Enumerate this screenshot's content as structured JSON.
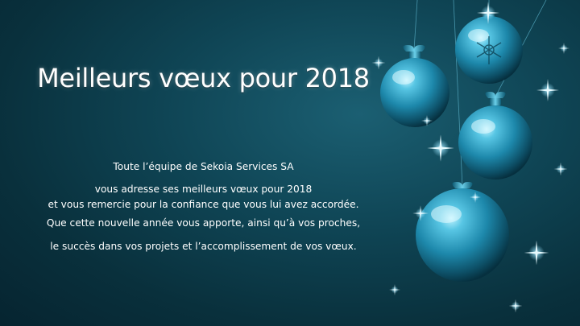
{
  "card": {
    "title": "Meilleurs vœux pour 2018",
    "message": [
      "Toute l’équipe de Sekoia Services SA",
      "vous adresse ses meilleurs vœux pour 2018",
      "et vous remercie pour la confiance que vous lui avez accordée.",
      "Que cette nouvelle année vous apporte, ainsi qu’à vos proches,",
      "le succès dans vos projets et l’accomplissement de vos vœux."
    ]
  },
  "colors": {
    "background": "#0f4555",
    "ornament": "#2aa7c9",
    "text": "#ffffff"
  }
}
